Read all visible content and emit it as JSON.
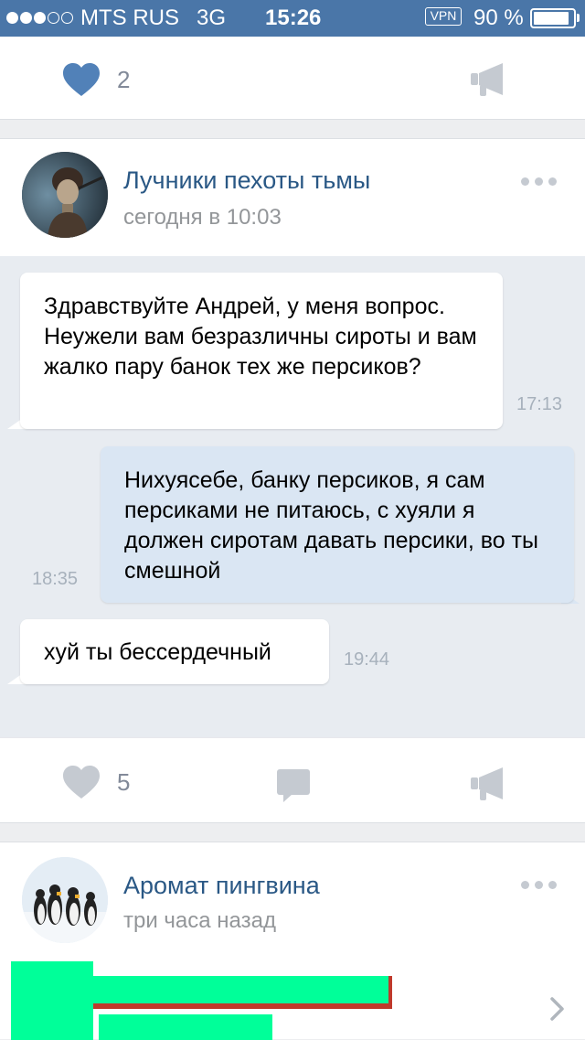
{
  "status_bar": {
    "carrier": "MTS RUS",
    "network": "3G",
    "time": "15:26",
    "vpn": "VPN",
    "battery": "90 %",
    "battery_level": 0.9,
    "signal_bars_filled": 3,
    "signal_bars_total": 5
  },
  "post_top": {
    "likes": "2"
  },
  "post_main": {
    "author": "Лучники пехоты тьмы",
    "time": "сегодня в 10:03",
    "messages": [
      {
        "direction": "in",
        "text": "Здравствуйте Андрей, у меня вопрос. Неужели вам безразличны сироты и вам жалко пару банок тех же персиков?",
        "time": "17:13"
      },
      {
        "direction": "out",
        "text": "Нихуясебе, банку персиков, я сам персиками не питаюсь, с хуяли я должен сиротам давать персики, во ты смешной",
        "time": "18:35"
      },
      {
        "direction": "in",
        "text": "хуй ты бессердечный",
        "time": "19:44"
      }
    ],
    "likes": "5"
  },
  "post_next": {
    "author": "Аромат пингвина",
    "time": "три часа назад"
  },
  "colors": {
    "status_bar": "#4a76a8",
    "link": "#2a5885",
    "like_active": "#5181b8",
    "icon_gray": "#c5cad1",
    "outgoing_bubble": "#dae6f3",
    "chat_background": "#e8ecf1",
    "redaction_green": "#00ff99",
    "redaction_red": "#c0392b"
  }
}
